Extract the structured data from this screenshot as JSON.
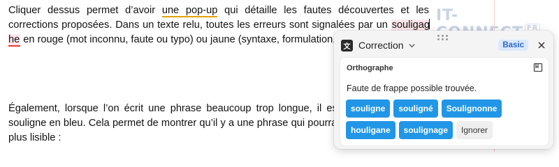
{
  "document": {
    "p1_before_style": "Cliquer dessus permet d’avoir ",
    "p1_style_word": "une pop-up",
    "p1_mid": " qui détaille les fautes découvertes et les corrections proposées. Dans un texte relu, toutes les erreurs sont signalées par un ",
    "p1_error_a": "souligag",
    "p1_error_b": "he",
    "p1_after": " en rouge (mot inconnu, faute ou typo) ou jaune (syntaxe, formulation, etc.) :",
    "p2": "Également, lorsque l’on écrit une phrase beaucoup trop longue, il est p souligne en bleu. Cela permet de montrer qu’il y a une phrase qui pourrait ê plus lisible :"
  },
  "watermark": {
    "text": "IT-CONNECT",
    "tag": "FR"
  },
  "popup": {
    "app_icon_glyph": "文",
    "title": "Correction",
    "badge": "Basic",
    "card_heading": "Orthographe",
    "message": "Faute de frappe possible trouvée.",
    "suggestions": [
      "souligne",
      "souligné",
      "Soulignonne",
      "houligane",
      "soulignage"
    ],
    "ignore_label": "Ignorer"
  },
  "colors": {
    "suggestion_bg": "#2196e6",
    "error": "#e53935",
    "style_hint": "#e0a000",
    "badge_bg": "#dbe9ff"
  }
}
